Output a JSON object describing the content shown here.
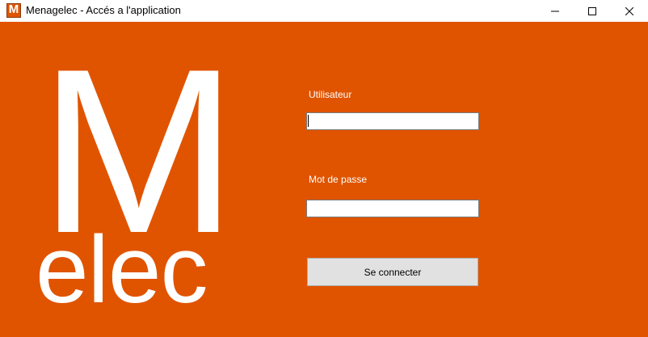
{
  "window": {
    "title": "Menagelec - Accés a l'application",
    "app_icon_letter": "M",
    "minimize_icon": "minimize-icon",
    "maximize_icon": "maximize-icon",
    "close_icon": "close-icon"
  },
  "logo": {
    "big_letter": "M",
    "word": "elec"
  },
  "form": {
    "user_label": "Utilisateur",
    "user_value": "",
    "password_label": "Mot de passe",
    "password_value": "",
    "connect_label": "Se connecter"
  },
  "colors": {
    "background": "#e05400",
    "text_on_background": "#ffffff",
    "button_face": "#e1e1e1"
  }
}
